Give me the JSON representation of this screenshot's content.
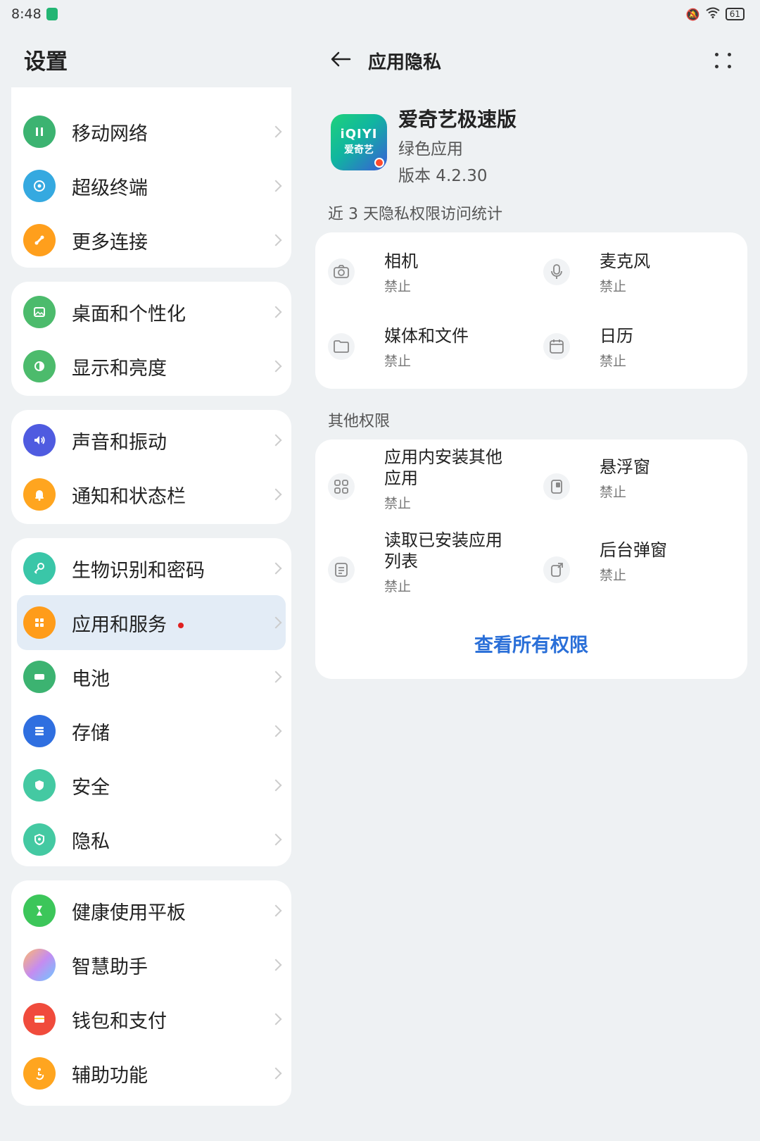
{
  "status_bar": {
    "time": "8:48",
    "battery": "61"
  },
  "left_panel": {
    "title": "设置",
    "items": [
      {
        "label": "移动网络",
        "icon": "mobile-network-icon",
        "color": "#3cb371"
      },
      {
        "label": "超级终端",
        "icon": "super-terminal-icon",
        "color": "#35a9e0"
      },
      {
        "label": "更多连接",
        "icon": "more-connections-icon",
        "color": "#ff9f1c"
      },
      {
        "label": "桌面和个性化",
        "icon": "desktop-personalization-icon",
        "color": "#4cbb6c"
      },
      {
        "label": "显示和亮度",
        "icon": "display-brightness-icon",
        "color": "#4cbb6c"
      },
      {
        "label": "声音和振动",
        "icon": "sound-vibration-icon",
        "color": "#4f5be0"
      },
      {
        "label": "通知和状态栏",
        "icon": "notification-bell-icon",
        "color": "#ffa51f"
      },
      {
        "label": "生物识别和密码",
        "icon": "biometric-key-icon",
        "color": "#3ac6a8"
      },
      {
        "label": "应用和服务",
        "icon": "apps-services-icon",
        "color": "#ff9c1a"
      },
      {
        "label": "电池",
        "icon": "battery-icon",
        "color": "#3cb371"
      },
      {
        "label": "存储",
        "icon": "storage-icon",
        "color": "#2f6fe0"
      },
      {
        "label": "安全",
        "icon": "security-shield-icon",
        "color": "#44c9a2"
      },
      {
        "label": "隐私",
        "icon": "privacy-shield-icon",
        "color": "#44c9a2"
      },
      {
        "label": "健康使用平板",
        "icon": "hourglass-icon",
        "color": "#3cc65a"
      },
      {
        "label": "智慧助手",
        "icon": "smart-assistant-icon",
        "color": "#a98ce8"
      },
      {
        "label": "钱包和支付",
        "icon": "wallet-icon",
        "color": "#f04b3c"
      },
      {
        "label": "辅助功能",
        "icon": "accessibility-icon",
        "color": "#ffa51f"
      }
    ]
  },
  "right_panel": {
    "title": "应用隐私",
    "app": {
      "name": "爱奇艺极速版",
      "tag": "绿色应用",
      "version": "版本 4.2.30",
      "logo_line1": "iQIYI",
      "logo_line2": "爱奇艺"
    },
    "section1": "近 3 天隐私权限访问统计",
    "privacy_perms": [
      {
        "title": "相机",
        "status": "禁止",
        "icon": "camera-icon"
      },
      {
        "title": "麦克风",
        "status": "禁止",
        "icon": "microphone-icon"
      },
      {
        "title": "媒体和文件",
        "status": "禁止",
        "icon": "folder-icon"
      },
      {
        "title": "日历",
        "status": "禁止",
        "icon": "calendar-icon"
      }
    ],
    "section2": "其他权限",
    "other_perms": [
      {
        "title1": "应用内安装其他",
        "title2": "应用",
        "status": "禁止",
        "icon": "install-apps-icon"
      },
      {
        "title1": "悬浮窗",
        "title2": "",
        "status": "禁止",
        "icon": "floating-window-icon"
      },
      {
        "title1": "读取已安装应用",
        "title2": "列表",
        "status": "禁止",
        "icon": "app-list-icon"
      },
      {
        "title1": "后台弹窗",
        "title2": "",
        "status": "禁止",
        "icon": "background-popup-icon"
      }
    ],
    "view_all": "查看所有权限",
    "accent": "#2a6fd8"
  }
}
